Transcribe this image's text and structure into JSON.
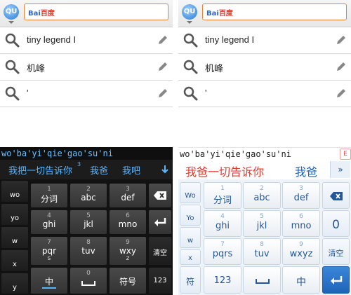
{
  "left": {
    "search": {
      "engine_logo": "QU",
      "brand_a": "Bai",
      "brand_b": "百度"
    },
    "suggestions": [
      {
        "text": "tiny legend I",
        "icon": "search-icon",
        "action_icon": "pencil-icon"
      },
      {
        "text": "机峰",
        "icon": "search-icon",
        "action_icon": "pencil-icon"
      },
      {
        "text": "'",
        "icon": "search-icon",
        "action_icon": "pencil-icon"
      }
    ],
    "keyboard": {
      "composition": "wo'ba'yi'qie'gao'su'ni",
      "candidates": [
        "我把一切告诉你",
        "我爸",
        "我吧"
      ],
      "candidate_sup": "3",
      "expand_icon": "down-arrow-icon",
      "side_keys": [
        "wo",
        "yo",
        "w",
        "x",
        "y"
      ],
      "row1": [
        {
          "sup": "1",
          "lbl": "分词"
        },
        {
          "sup": "2",
          "lbl": "abc"
        },
        {
          "sup": "3",
          "lbl": "def"
        }
      ],
      "row2": [
        {
          "sup": "4",
          "lbl": "ghi"
        },
        {
          "sup": "5",
          "lbl": "jkl"
        },
        {
          "sup": "6",
          "lbl": "mno"
        }
      ],
      "row3": [
        {
          "sup": "7",
          "lbl": "pqr",
          "sub": "s"
        },
        {
          "sup": "8",
          "lbl": "tuv"
        },
        {
          "sup": "9",
          "lbl": "wxy",
          "sub": "z"
        }
      ],
      "bottom": {
        "zh": "中",
        "space_sup": "0",
        "symbol": "符号",
        "num": "123"
      },
      "backspace_icon": "backspace-icon",
      "enter_icon": "enter-icon",
      "clear": "清空"
    }
  },
  "right": {
    "search": {
      "engine_logo": "QU",
      "brand_a": "Bai",
      "brand_b": "百度"
    },
    "suggestions": [
      {
        "text": "tiny legend I",
        "icon": "search-icon",
        "action_icon": "pencil-icon"
      },
      {
        "text": "机峰",
        "icon": "search-icon",
        "action_icon": "pencil-icon"
      },
      {
        "text": "'",
        "icon": "search-icon",
        "action_icon": "pencil-icon"
      }
    ],
    "keyboard": {
      "composition": "wo'ba'yi'qie'gao'su'ni",
      "candidates": [
        "我爸一切告诉你",
        "我爸"
      ],
      "more": "»",
      "corner_badge": "E",
      "side_keys": [
        "Wo",
        "Yo",
        "w",
        "x"
      ],
      "row1": [
        {
          "sup": "1",
          "lbl": "分词"
        },
        {
          "sup": "2",
          "lbl": "abc"
        },
        {
          "sup": "3",
          "lbl": "def"
        }
      ],
      "row2": [
        {
          "sup": "4",
          "lbl": "ghi"
        },
        {
          "sup": "5",
          "lbl": "jkl"
        },
        {
          "sup": "6",
          "lbl": "mno"
        }
      ],
      "row3": [
        {
          "sup": "7",
          "lbl": "pqrs"
        },
        {
          "sup": "8",
          "lbl": "tuv"
        },
        {
          "sup": "9",
          "lbl": "wxyz"
        }
      ],
      "right_col": {
        "zero": "0",
        "clear": "清空"
      },
      "bottom": {
        "symbol": "符",
        "num": "123",
        "zh": "中"
      },
      "backspace_icon": "backspace-icon",
      "space_icon": "space-icon",
      "enter_icon": "enter-icon"
    }
  },
  "colors": {
    "accent_orange": "#e8823a",
    "dark_candidate_blue": "#5ab6ff",
    "light_candidate_red": "#e03a2e",
    "light_key_blue": "#24579a"
  }
}
